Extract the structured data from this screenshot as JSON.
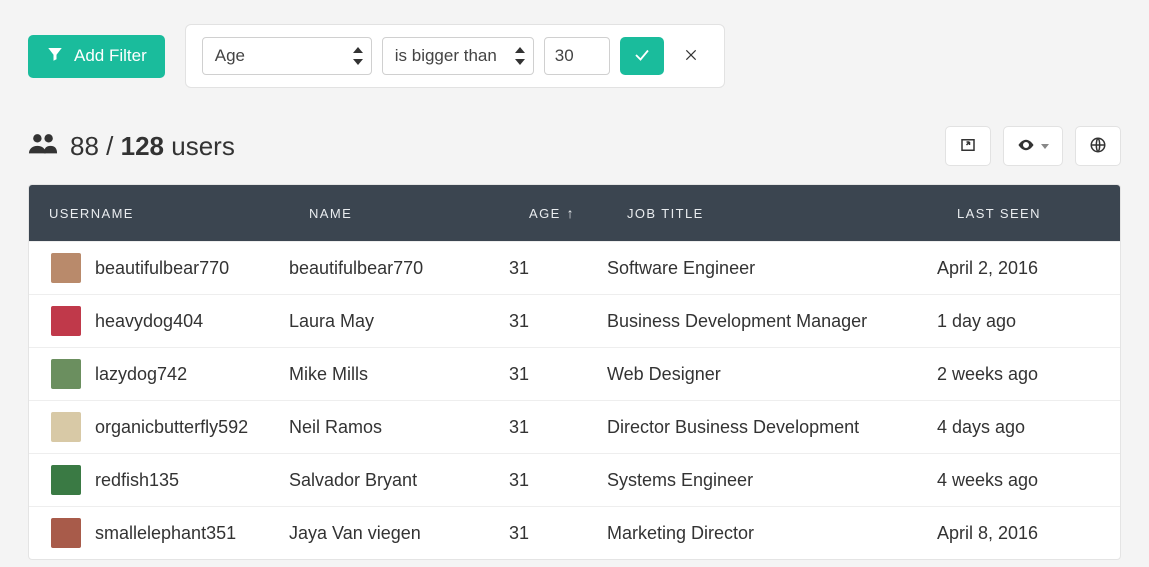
{
  "colors": {
    "accent": "#1abc9c",
    "header_bg": "#3b4550"
  },
  "filter": {
    "add_label": "Add Filter",
    "field": "Age",
    "operator": "is bigger than",
    "value": "30"
  },
  "summary": {
    "filtered": "88",
    "sep": "/",
    "total": "128",
    "noun": "users"
  },
  "columns": {
    "username": "USERNAME",
    "name": "NAME",
    "age": "AGE",
    "age_sort_indicator": "↑",
    "job": "JOB TITLE",
    "last": "LAST SEEN"
  },
  "rows": [
    {
      "avatar_color": "#b98a6b",
      "username": "beautifulbear770",
      "name": "beautifulbear770",
      "age": "31",
      "job": "Software Engineer",
      "last_seen": "April 2, 2016"
    },
    {
      "avatar_color": "#c0394a",
      "username": "heavydog404",
      "name": "Laura May",
      "age": "31",
      "job": "Business Development Manager",
      "last_seen": "1 day ago"
    },
    {
      "avatar_color": "#6b8f5f",
      "username": "lazydog742",
      "name": "Mike Mills",
      "age": "31",
      "job": "Web Designer",
      "last_seen": "2 weeks ago"
    },
    {
      "avatar_color": "#d8c9a6",
      "username": "organicbutterfly592",
      "name": "Neil Ramos",
      "age": "31",
      "job": "Director Business Development",
      "last_seen": "4 days ago"
    },
    {
      "avatar_color": "#3a7a44",
      "username": "redfish135",
      "name": "Salvador Bryant",
      "age": "31",
      "job": "Systems Engineer",
      "last_seen": "4 weeks ago"
    },
    {
      "avatar_color": "#a85b4a",
      "username": "smallelephant351",
      "name": "Jaya Van viegen",
      "age": "31",
      "job": "Marketing Director",
      "last_seen": "April 8, 2016"
    }
  ]
}
